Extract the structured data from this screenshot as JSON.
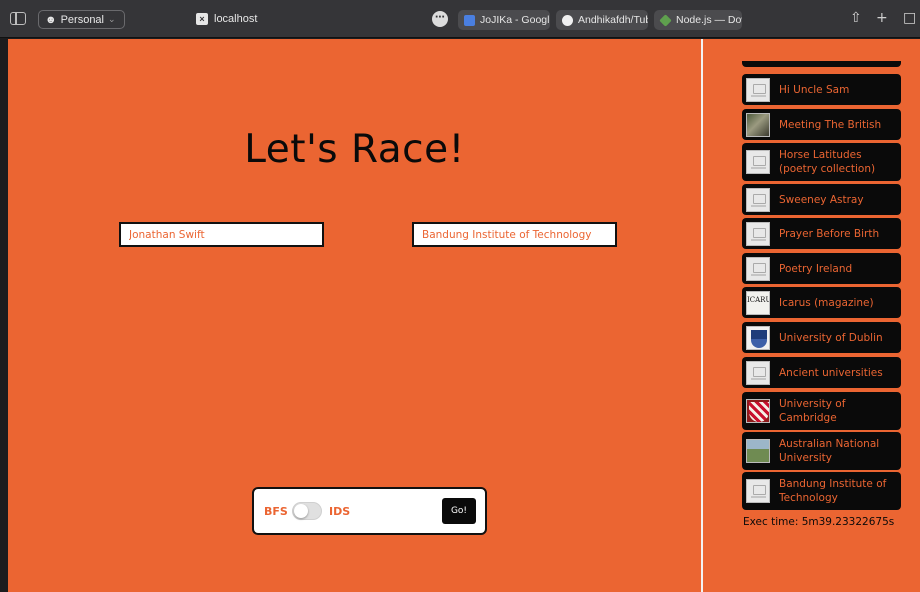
{
  "browser": {
    "profile": "Personal",
    "active_tab_title": "localhost",
    "tabs": [
      {
        "label": "JoJIKa - Google...",
        "color": "#4a7fe0"
      },
      {
        "label": "Andhikafdh/Tub...",
        "color": "#2d2d2d"
      },
      {
        "label": "Node.js — Down...",
        "color": "#5fa04e"
      }
    ]
  },
  "race": {
    "title": "Let's Race!",
    "start_article": "Jonathan Swift",
    "target_article": "Bandung Institute of Technology",
    "algo_left": "BFS",
    "algo_right": "IDS",
    "go_label": "Go!"
  },
  "results": {
    "path": [
      {
        "label": "Hi Uncle Sam",
        "thumb": "placeholder"
      },
      {
        "label": "Meeting The British",
        "thumb": "photo"
      },
      {
        "label": "Horse Latitudes (poetry collection)",
        "thumb": "placeholder"
      },
      {
        "label": "Sweeney Astray",
        "thumb": "placeholder"
      },
      {
        "label": "Prayer Before Birth",
        "thumb": "placeholder"
      },
      {
        "label": "Poetry Ireland",
        "thumb": "placeholder"
      },
      {
        "label": "Icarus (magazine)",
        "thumb": "icarus"
      },
      {
        "label": "University of Dublin",
        "thumb": "crest-dublin"
      },
      {
        "label": "Ancient universities",
        "thumb": "placeholder"
      },
      {
        "label": "University of Cambridge",
        "thumb": "crest-cam"
      },
      {
        "label": "Australian National University",
        "thumb": "anu"
      },
      {
        "label": "Bandung Institute of Technology",
        "thumb": "placeholder"
      }
    ],
    "exec_time": "Exec time: 5m39.23322675s",
    "icarus_thumb_text": "ICARUS"
  },
  "colors": {
    "accent": "#eb6532",
    "dark": "#0a0a0a"
  }
}
